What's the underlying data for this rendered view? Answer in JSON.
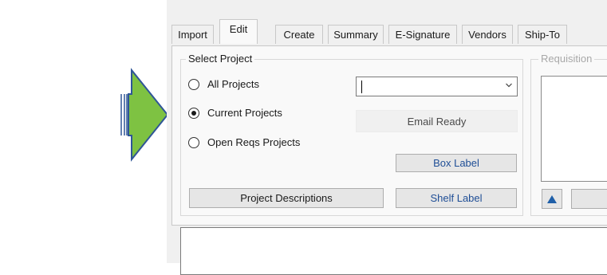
{
  "tabs": [
    {
      "label": "Import",
      "active": false
    },
    {
      "label": "Edit",
      "active": true
    },
    {
      "label": "Create",
      "active": false
    },
    {
      "label": "Summary",
      "active": false
    },
    {
      "label": "E-Signature",
      "active": false
    },
    {
      "label": "Vendors",
      "active": false
    },
    {
      "label": "Ship-To",
      "active": false
    }
  ],
  "select_project": {
    "legend": "Select Project",
    "options": [
      {
        "label": "All Projects",
        "checked": false
      },
      {
        "label": "Current Projects",
        "checked": true
      },
      {
        "label": "Open Reqs Projects",
        "checked": false
      }
    ],
    "combo_value": "",
    "status_text": "Email Ready",
    "box_label_button": "Box Label",
    "shelf_label_button": "Shelf Label",
    "project_descriptions_button": "Project Descriptions"
  },
  "requisition": {
    "legend": "Requisition"
  },
  "colors": {
    "arrow_fill": "#7ec242",
    "arrow_stroke": "#2f5597",
    "link_text": "#1f4e96",
    "up_arrow": "#1f5fa8"
  },
  "icons": {
    "arrow": "right-arrow-icon",
    "dropdown": "chevron-down-icon",
    "move_up": "triangle-up-icon"
  }
}
